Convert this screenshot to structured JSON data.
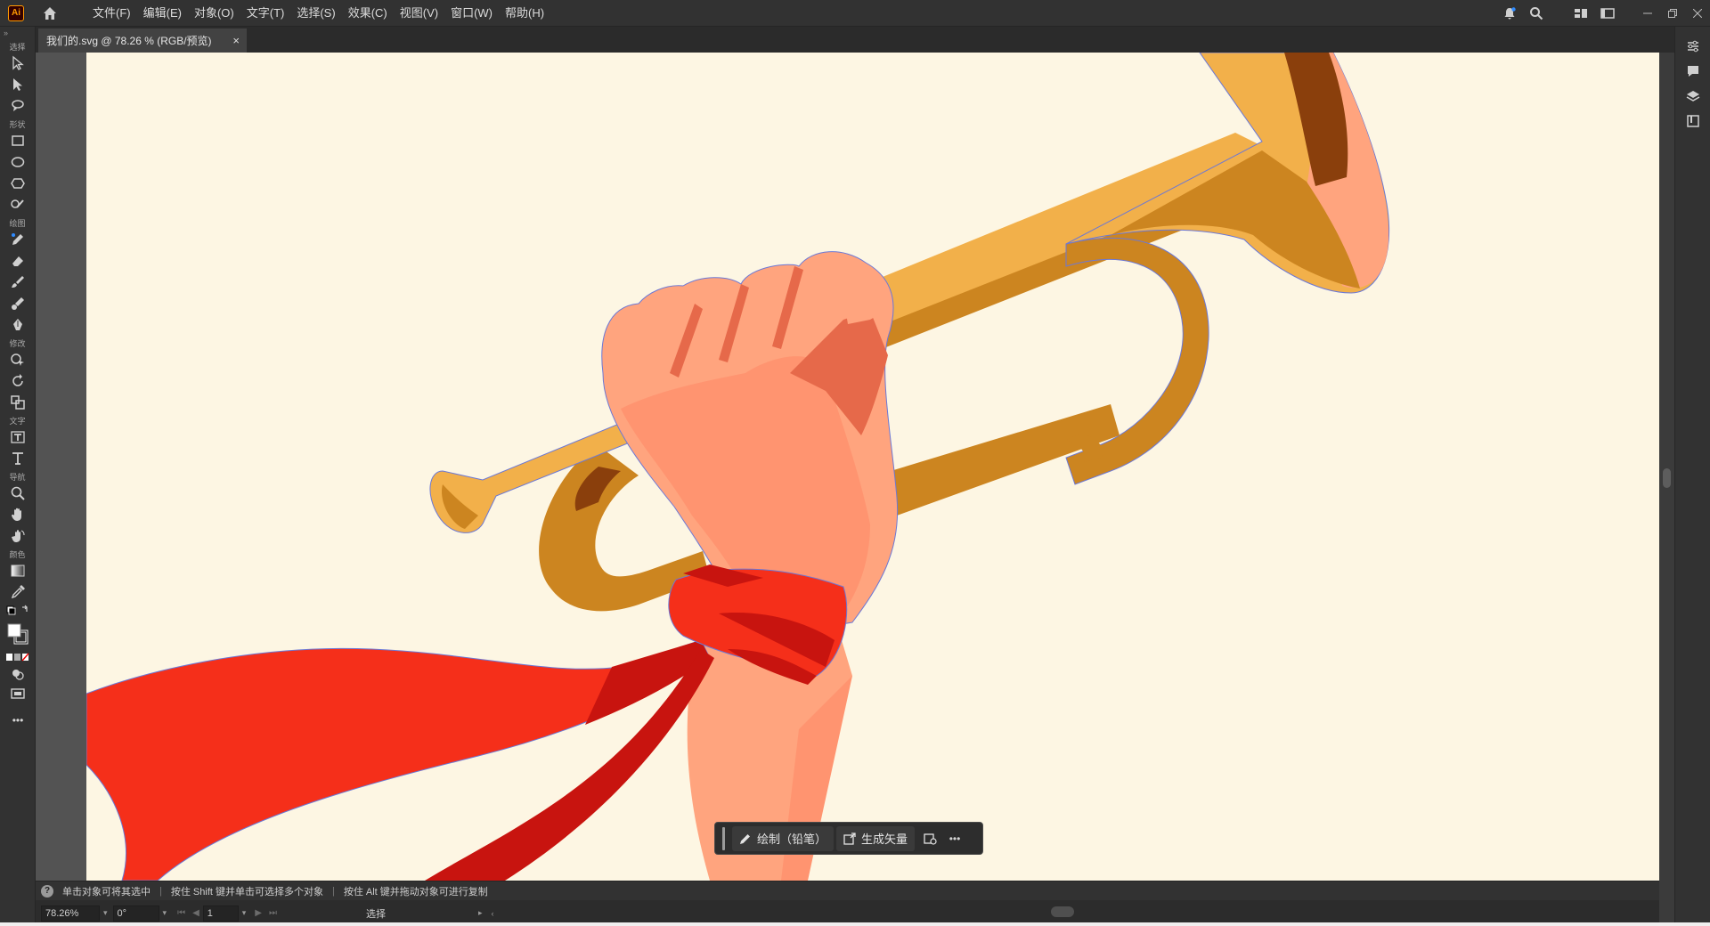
{
  "app": {
    "logo_text": "Ai",
    "accent_color": "#ff9a00"
  },
  "menu": {
    "items": [
      {
        "label": "文件(F)"
      },
      {
        "label": "编辑(E)"
      },
      {
        "label": "对象(O)"
      },
      {
        "label": "文字(T)"
      },
      {
        "label": "选择(S)"
      },
      {
        "label": "效果(C)"
      },
      {
        "label": "视图(V)"
      },
      {
        "label": "窗口(W)"
      },
      {
        "label": "帮助(H)"
      }
    ]
  },
  "document_tab": {
    "title": "我们的.svg @ 78.26 % (RGB/预览)",
    "close": "×"
  },
  "toolbar": {
    "collapse": "»",
    "groups": {
      "select": "选择",
      "shape": "形状",
      "draw": "绘图",
      "modify": "修改",
      "type": "文字",
      "nav": "导航",
      "color": "颜色"
    },
    "more": "•••"
  },
  "taskbar": {
    "draw_label": "绘制（铅笔）",
    "generate_label": "生成矢量",
    "more": "•••"
  },
  "hints": {
    "h1": "单击对象可将其选中",
    "h2": "按住 Shift 键并单击可选择多个对象",
    "h3": "按住 Alt 键并拖动对象可进行复制",
    "separator": "|",
    "help": "?"
  },
  "status": {
    "zoom": "78.26%",
    "rotation": "0°",
    "page": "1",
    "tool": "选择"
  },
  "colors": {
    "artboard_bg": "#fdf6e3",
    "trumpet": "#f2b04a",
    "trumpet_dark": "#cc8520",
    "skin": "#ffa47e",
    "skin_shadow": "#e6694a",
    "ribbon": "#f52f1a",
    "ribbon_dark": "#c8140f"
  }
}
